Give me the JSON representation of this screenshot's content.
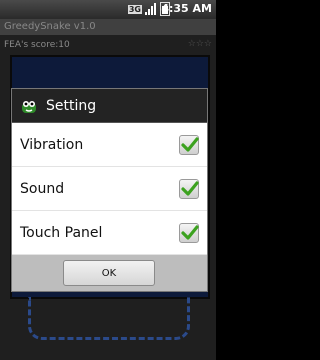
{
  "statusbar": {
    "network": "3G",
    "time": "4:35 AM"
  },
  "app": {
    "title": "GreedySnake v1.0",
    "score_label": "FEA's score:10",
    "stars": "☆☆☆"
  },
  "dialog": {
    "title": "Setting",
    "options": [
      {
        "label": "Vibration",
        "checked": true
      },
      {
        "label": "Sound",
        "checked": true
      },
      {
        "label": "Touch Panel",
        "checked": true
      }
    ],
    "ok_label": "OK"
  },
  "colors": {
    "check_green": "#3ca21f",
    "board": "#0d1a3a",
    "title_bar": "#232323",
    "footer": "#bdbdbd"
  },
  "icons": {
    "dialog": "snake-icon",
    "checkbox": "checkmark-icon"
  }
}
